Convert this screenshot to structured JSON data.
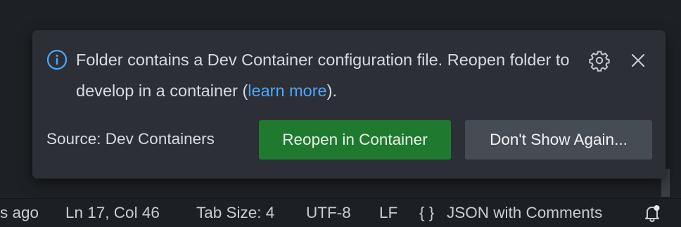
{
  "notification": {
    "message_part1": "Folder contains a Dev Container configuration file. Reopen folder to develop in a container (",
    "link_text": "learn more",
    "message_part2": ").",
    "source": "Source: Dev Containers",
    "primary_button": "Reopen in Container",
    "secondary_button": "Don't Show Again..."
  },
  "statusbar": {
    "time": "s ago",
    "position": "Ln 17, Col 46",
    "tab_size": "Tab Size: 4",
    "encoding": "UTF-8",
    "eol": "LF",
    "language": "JSON with Comments",
    "language_icon": "{ }"
  },
  "icons": {
    "info": "info-icon",
    "settings": "gear-icon",
    "close": "close-icon",
    "notifications": "bell-icon"
  },
  "colors": {
    "link": "#4da6ff",
    "primary_button": "#1f7a2f",
    "secondary_button": "#464c54",
    "info_icon": "#4da6ff"
  }
}
